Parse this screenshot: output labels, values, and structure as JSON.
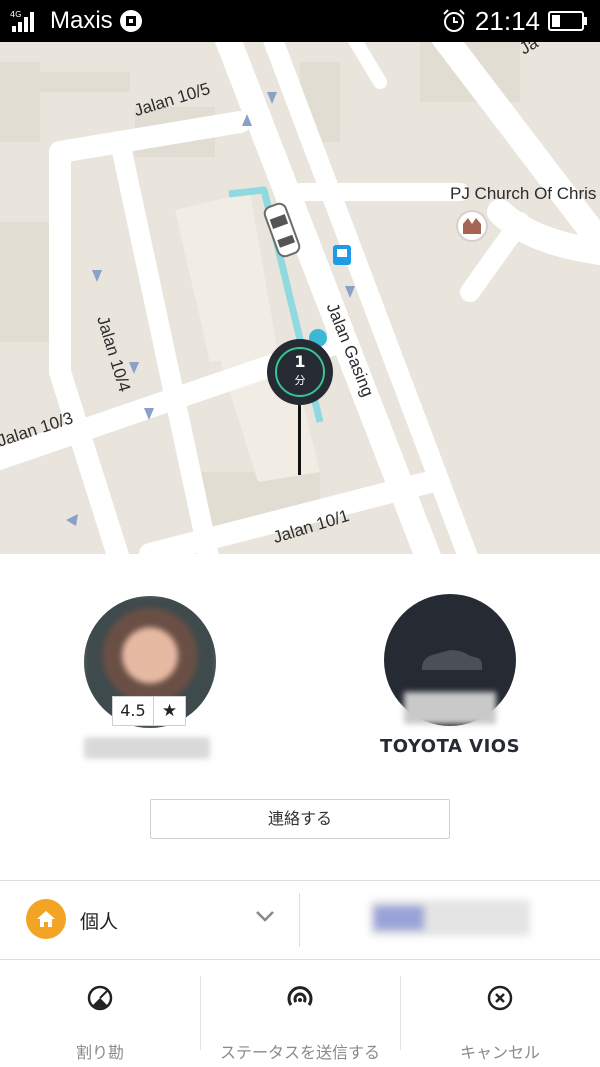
{
  "status_bar": {
    "network": "4G",
    "carrier": "Maxis",
    "time": "21:14"
  },
  "map": {
    "streets": [
      "Jalan 10/5",
      "Jalan 10/4",
      "Jalan 10/3",
      "Jalan Gasing",
      "Jalan 10/1",
      "Ja"
    ],
    "poi": "PJ Church Of Chris",
    "eta": {
      "value": "1",
      "unit": "分"
    },
    "colors": {
      "land": "#e9e5dc",
      "road": "#ffffff",
      "route": "#8fd9e0",
      "pin": "#262a33",
      "ring": "#36c48f",
      "bus": "#1e9be6"
    }
  },
  "driver": {
    "rating": "4.5",
    "star": "★"
  },
  "vehicle": {
    "model": "TOYOTA VIOS"
  },
  "contact_button": "連絡する",
  "profile": {
    "label": "個人",
    "icon": "home-icon",
    "accent": "#f4a424"
  },
  "actions": [
    {
      "label": "割り勘",
      "icon": "split-fare-icon"
    },
    {
      "label": "ステータスを送信する",
      "icon": "share-status-icon"
    },
    {
      "label": "キャンセル",
      "icon": "cancel-icon"
    }
  ]
}
